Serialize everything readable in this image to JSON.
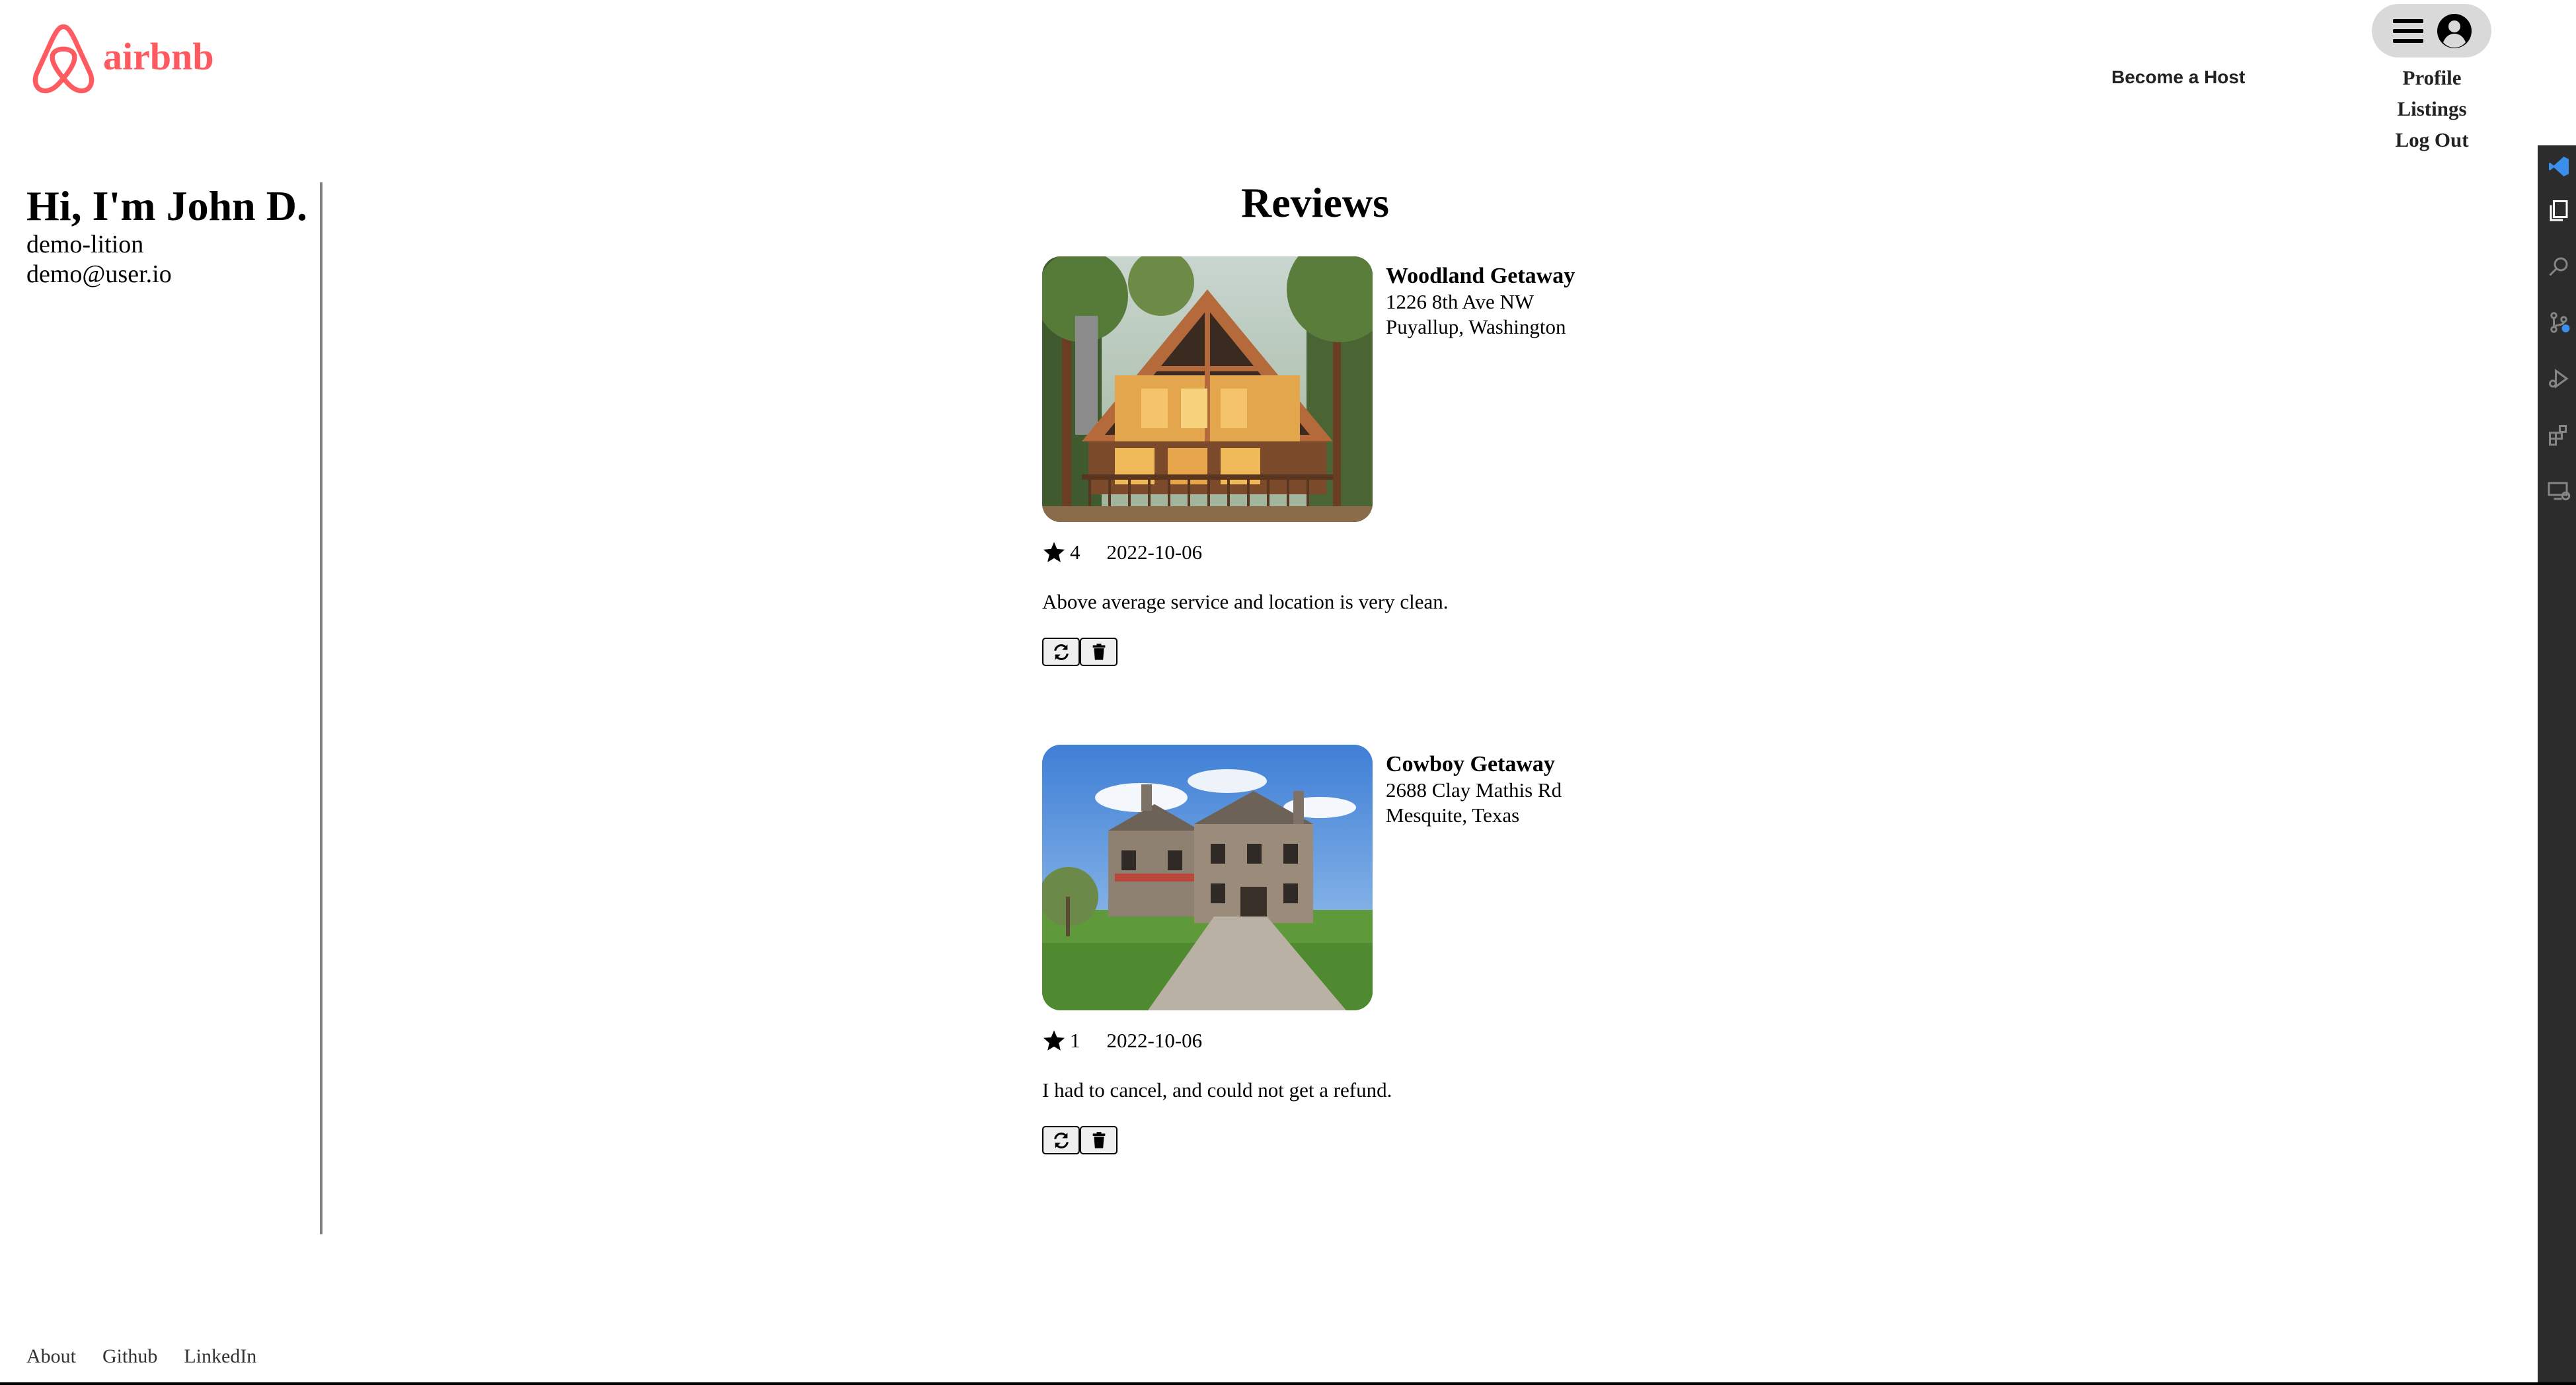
{
  "header": {
    "logo_text": "airbnb",
    "brand_color": "#ff5a5f",
    "become_host": "Become a Host",
    "menu": {
      "items": [
        "Profile",
        "Listings",
        "Log Out"
      ]
    }
  },
  "sidebar": {
    "greeting": "Hi, I'm John D.",
    "username": "demo-lition",
    "email": "demo@user.io"
  },
  "main": {
    "title": "Reviews",
    "reviews": [
      {
        "listing_name": "Woodland Getaway",
        "address": "1226 8th Ave NW",
        "city_state": "Puyallup, Washington",
        "rating": "4",
        "date": "2022-10-06",
        "text": "Above average service and location is very clean."
      },
      {
        "listing_name": "Cowboy Getaway",
        "address": "2688 Clay Mathis Rd",
        "city_state": "Mesquite, Texas",
        "rating": "1",
        "date": "2022-10-06",
        "text": "I had to cancel, and could not get a refund."
      }
    ]
  },
  "footer": {
    "links": [
      "About",
      "Github",
      "LinkedIn"
    ]
  }
}
